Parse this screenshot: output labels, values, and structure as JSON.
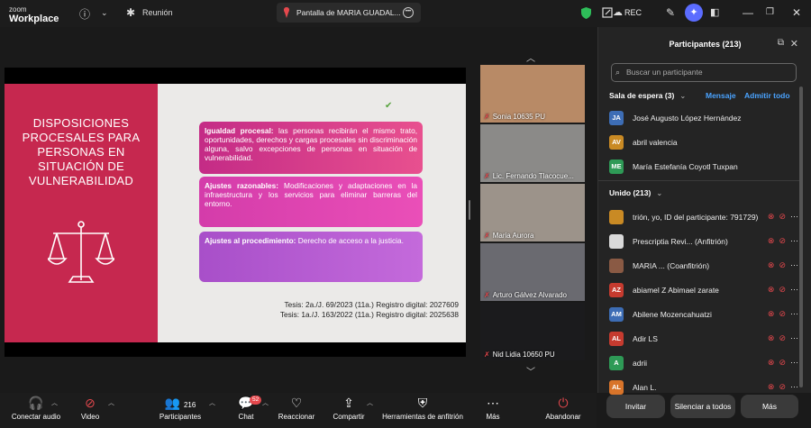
{
  "app": {
    "logo_small": "zoom",
    "logo_main": "Workplace",
    "meeting_label": "Reunión",
    "share_label": "Pantalla de MARIA GUADAL...",
    "rec_label": "REC"
  },
  "slide": {
    "title": "DISPOSICIONES PROCESALES PARA PERSONAS EN SITUACIÓN DE VULNERABILIDAD",
    "card1_bold": "Igualdad procesal:",
    "card1_text": " las personas recibirán el mismo trato, oportunidades, derechos y cargas procesales sin discriminación alguna, salvo excepciones de personas en situación de vulnerabilidad.",
    "card2_bold": "Ajustes razonables:",
    "card2_text": " Modificaciones y adaptaciones en la infraestructura y los servicios para eliminar barreras del entorno.",
    "card3_bold": "Ajustes al procedimiento:",
    "card3_text": " Derecho de acceso a la justicia.",
    "tesis1": "Tesis: 2a./J. 69/2023 (11a.)  Registro digital: 2027609",
    "tesis2": "Tesis: 1a./J. 163/2022 (11a.) Registro digital: 2025638"
  },
  "videos": [
    {
      "name": "Sonia 10635 PU",
      "bg": "#b88a66"
    },
    {
      "name": "Lic. Fernando Tlacocue...",
      "bg": "#8b8a88"
    },
    {
      "name": "Maria Aurora",
      "bg": "#9c938a"
    },
    {
      "name": "Arturo Gálvez Alvarado",
      "bg": "#6a6a70"
    },
    {
      "name": "Nid Lidia 10650 PU",
      "bg": "#1b1b1d"
    }
  ],
  "panel": {
    "title": "Participantes (213)",
    "search_placeholder": "Buscar un participante",
    "waiting": "Sala de espera (3)",
    "message": "Mensaje",
    "admit_all": "Admitir todo",
    "waiting_list": [
      {
        "initials": "JA",
        "name": "José Augusto López Hernández",
        "color": "#3d6db5"
      },
      {
        "initials": "AV",
        "name": "abril valencia",
        "color": "#c98a24"
      },
      {
        "initials": "ME",
        "name": "María Estefanía Coyotl Tuxpan",
        "color": "#2e9a56"
      }
    ],
    "joined": "Unido (213)",
    "joined_list": [
      {
        "initials": "",
        "name": "trión, yo, ID del participante: 791729)",
        "color": "#c98a24"
      },
      {
        "initials": "",
        "name": "Prescriptia Revi... (Anfitrión)",
        "color": "#d9d9d9"
      },
      {
        "initials": "",
        "name": "MARIA ... (Coanfitrión)",
        "color": "#8a5a44"
      },
      {
        "initials": "AZ",
        "name": "abiamel Z Abimael zarate",
        "color": "#c63b2f"
      },
      {
        "initials": "AM",
        "name": "Abilene Mozencahuatzi",
        "color": "#3d6db5"
      },
      {
        "initials": "AL",
        "name": "Adir LS",
        "color": "#c63b2f"
      },
      {
        "initials": "A",
        "name": "adrii",
        "color": "#2e9a56"
      },
      {
        "initials": "AL",
        "name": "Alan L.",
        "color": "#d8742a"
      }
    ],
    "btn_invite": "Invitar",
    "btn_request": "Silenciar a todos",
    "btn_more": "Más"
  },
  "toolbar": {
    "audio": "Conectar audio",
    "video": "Video",
    "participants": "Participantes",
    "participants_count": "216",
    "chat": "Chat",
    "chat_badge": "52",
    "reactions": "Reaccionar",
    "share": "Compartir",
    "host_tools": "Herramientas de anfitrión",
    "more": "Más",
    "leave": "Abandonar"
  }
}
